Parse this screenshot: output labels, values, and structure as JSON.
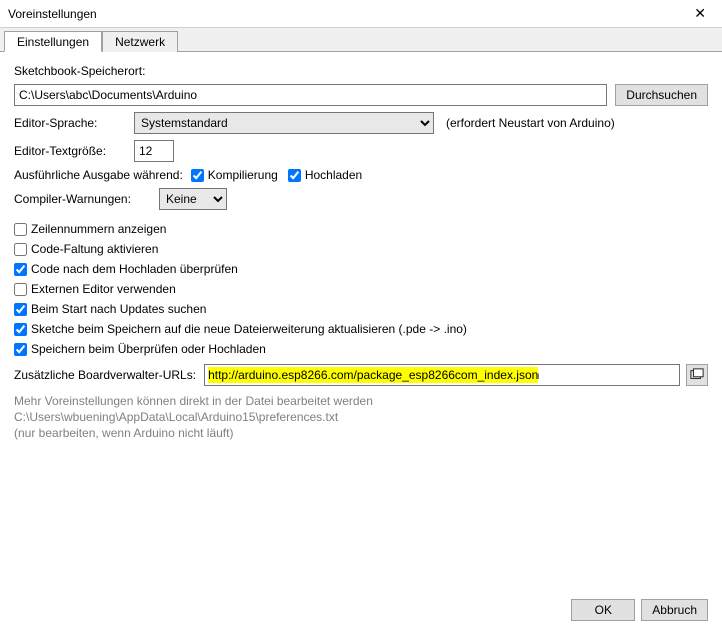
{
  "window": {
    "title": "Voreinstellungen"
  },
  "tabs": {
    "settings": "Einstellungen",
    "network": "Netzwerk"
  },
  "sketchbook": {
    "label": "Sketchbook-Speicherort:",
    "value": "C:\\Users\\abc\\Documents\\Arduino",
    "browse": "Durchsuchen"
  },
  "editorLang": {
    "label": "Editor-Sprache:",
    "value": "Systemstandard",
    "hint": "(erfordert Neustart von Arduino)"
  },
  "fontSize": {
    "label": "Editor-Textgröße:",
    "value": "12"
  },
  "verbose": {
    "label": "Ausführliche Ausgabe während:",
    "compile": "Kompilierung",
    "upload": "Hochladen"
  },
  "warnings": {
    "label": "Compiler-Warnungen:",
    "value": "Keine"
  },
  "checks": {
    "lineNumbers": "Zeilennummern anzeigen",
    "codeFolding": "Code-Faltung aktivieren",
    "verifyAfterUpload": "Code nach dem Hochladen überprüfen",
    "externalEditor": "Externen Editor verwenden",
    "checkUpdates": "Beim Start nach Updates suchen",
    "updateExt": "Sketche beim Speichern auf die neue Dateierweiterung aktualisieren (.pde -> .ino)",
    "saveOnVerify": "Speichern beim Überprüfen oder Hochladen"
  },
  "boardsUrls": {
    "label": "Zusätzliche Boardverwalter-URLs:",
    "value": "http://arduino.esp8266.com/package_esp8266com_index.json"
  },
  "notes": {
    "line1": "Mehr Voreinstellungen können direkt in der Datei bearbeitet werden",
    "line2": "C:\\Users\\wbuening\\AppData\\Local\\Arduino15\\preferences.txt",
    "line3": "(nur bearbeiten, wenn Arduino nicht läuft)"
  },
  "footer": {
    "ok": "OK",
    "cancel": "Abbruch"
  }
}
